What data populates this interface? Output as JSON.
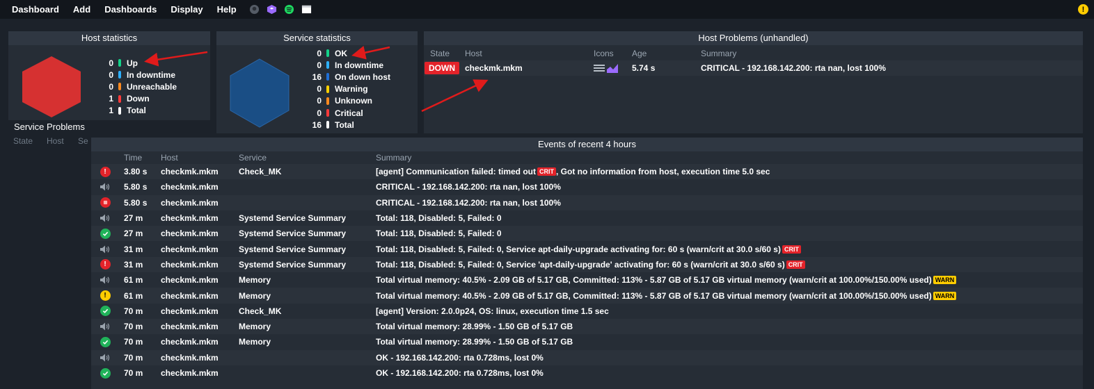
{
  "menu": [
    "Dashboard",
    "Add",
    "Dashboards",
    "Display",
    "Help"
  ],
  "top_icons": [
    "github-icon",
    "box-icon",
    "spotify-icon",
    "window-icon"
  ],
  "host_statistics": {
    "title": "Host statistics",
    "hexagon_color": "#d63131",
    "rows": [
      {
        "count": "0",
        "label": "Up",
        "color": "#13d389"
      },
      {
        "count": "0",
        "label": "In downtime",
        "color": "#2db0ff"
      },
      {
        "count": "0",
        "label": "Unreachable",
        "color": "#ff8a1f"
      },
      {
        "count": "1",
        "label": "Down",
        "color": "#ff3a3a"
      },
      {
        "count": "1",
        "label": "Total",
        "color": "#ffffff"
      }
    ]
  },
  "service_statistics": {
    "title": "Service statistics",
    "hexagon_color": "#1a4e85",
    "rows": [
      {
        "count": "0",
        "label": "OK",
        "color": "#13d389"
      },
      {
        "count": "0",
        "label": "In downtime",
        "color": "#2db0ff"
      },
      {
        "count": "16",
        "label": "On down host",
        "color": "#1f6fd6"
      },
      {
        "count": "0",
        "label": "Warning",
        "color": "#ffd000"
      },
      {
        "count": "0",
        "label": "Unknown",
        "color": "#ff8a1f"
      },
      {
        "count": "0",
        "label": "Critical",
        "color": "#ff3a3a"
      },
      {
        "count": "16",
        "label": "Total",
        "color": "#ffffff"
      }
    ]
  },
  "host_problems": {
    "title": "Host Problems (unhandled)",
    "headers": {
      "state": "State",
      "host": "Host",
      "icons": "Icons",
      "age": "Age",
      "summary": "Summary"
    },
    "rows": [
      {
        "state": "DOWN",
        "host": "checkmk.mkm",
        "age": "5.74 s",
        "summary": "CRITICAL - 192.168.142.200: rta nan, lost 100%"
      }
    ]
  },
  "service_problems": {
    "title": "Service Problems",
    "headers": [
      "State",
      "Host",
      "Se"
    ]
  },
  "events": {
    "title": "Events of recent 4 hours",
    "headers": {
      "time": "Time",
      "host": "Host",
      "service": "Service",
      "summary": "Summary"
    },
    "rows": [
      {
        "icon": "crit",
        "time": "3.80 s",
        "host": "checkmk.mkm",
        "service": "Check_MK",
        "summary": "[agent] Communication failed: timed out",
        "tag": "CRIT",
        "summary2": ", Got no information from host, execution time 5.0 sec"
      },
      {
        "icon": "speaker",
        "time": "5.80 s",
        "host": "checkmk.mkm",
        "service": "",
        "summary": "CRITICAL - 192.168.142.200: rta nan, lost 100%",
        "tag": "",
        "summary2": ""
      },
      {
        "icon": "down",
        "time": "5.80 s",
        "host": "checkmk.mkm",
        "service": "",
        "summary": "CRITICAL - 192.168.142.200: rta nan, lost 100%",
        "tag": "",
        "summary2": ""
      },
      {
        "icon": "speaker",
        "time": "27 m",
        "host": "checkmk.mkm",
        "service": "Systemd Service Summary",
        "summary": "Total: 118, Disabled: 5, Failed: 0",
        "tag": "",
        "summary2": ""
      },
      {
        "icon": "ok",
        "time": "27 m",
        "host": "checkmk.mkm",
        "service": "Systemd Service Summary",
        "summary": "Total: 118, Disabled: 5, Failed: 0",
        "tag": "",
        "summary2": ""
      },
      {
        "icon": "speaker",
        "time": "31 m",
        "host": "checkmk.mkm",
        "service": "Systemd Service Summary",
        "summary": "Total: 118, Disabled: 5, Failed: 0, Service apt-daily-upgrade activating for: 60 s (warn/crit at 30.0 s/60 s)",
        "tag": "CRIT",
        "summary2": ""
      },
      {
        "icon": "crit",
        "time": "31 m",
        "host": "checkmk.mkm",
        "service": "Systemd Service Summary",
        "summary": "Total: 118, Disabled: 5, Failed: 0, Service 'apt-daily-upgrade' activating for: 60 s (warn/crit at 30.0 s/60 s)",
        "tag": "CRIT",
        "summary2": ""
      },
      {
        "icon": "speaker",
        "time": "61 m",
        "host": "checkmk.mkm",
        "service": "Memory",
        "summary": "Total virtual memory: 40.5% - 2.09 GB of 5.17 GB, Committed: 113% - 5.87 GB of 5.17 GB virtual memory (warn/crit at 100.00%/150.00% used)",
        "tag": "WARN",
        "summary2": ""
      },
      {
        "icon": "warn",
        "time": "61 m",
        "host": "checkmk.mkm",
        "service": "Memory",
        "summary": "Total virtual memory: 40.5% - 2.09 GB of 5.17 GB, Committed: 113% - 5.87 GB of 5.17 GB virtual memory (warn/crit at 100.00%/150.00% used)",
        "tag": "WARN",
        "summary2": ""
      },
      {
        "icon": "ok",
        "time": "70 m",
        "host": "checkmk.mkm",
        "service": "Check_MK",
        "summary": "[agent] Version: 2.0.0p24, OS: linux, execution time 1.5 sec",
        "tag": "",
        "summary2": ""
      },
      {
        "icon": "speaker",
        "time": "70 m",
        "host": "checkmk.mkm",
        "service": "Memory",
        "summary": "Total virtual memory: 28.99% - 1.50 GB of 5.17 GB",
        "tag": "",
        "summary2": ""
      },
      {
        "icon": "ok",
        "time": "70 m",
        "host": "checkmk.mkm",
        "service": "Memory",
        "summary": "Total virtual memory: 28.99% - 1.50 GB of 5.17 GB",
        "tag": "",
        "summary2": ""
      },
      {
        "icon": "speaker",
        "time": "70 m",
        "host": "checkmk.mkm",
        "service": "",
        "summary": "OK - 192.168.142.200: rta 0.728ms, lost 0%",
        "tag": "",
        "summary2": ""
      },
      {
        "icon": "ok",
        "time": "70 m",
        "host": "checkmk.mkm",
        "service": "",
        "summary": "OK - 192.168.142.200: rta 0.728ms, lost 0%",
        "tag": "",
        "summary2": ""
      }
    ]
  },
  "colors": {
    "crit": "#e3232a",
    "ok": "#20b35a",
    "warn": "#ffcc00",
    "down_badge": "#e3232a",
    "annotation_arrow": "#e01b1b"
  }
}
